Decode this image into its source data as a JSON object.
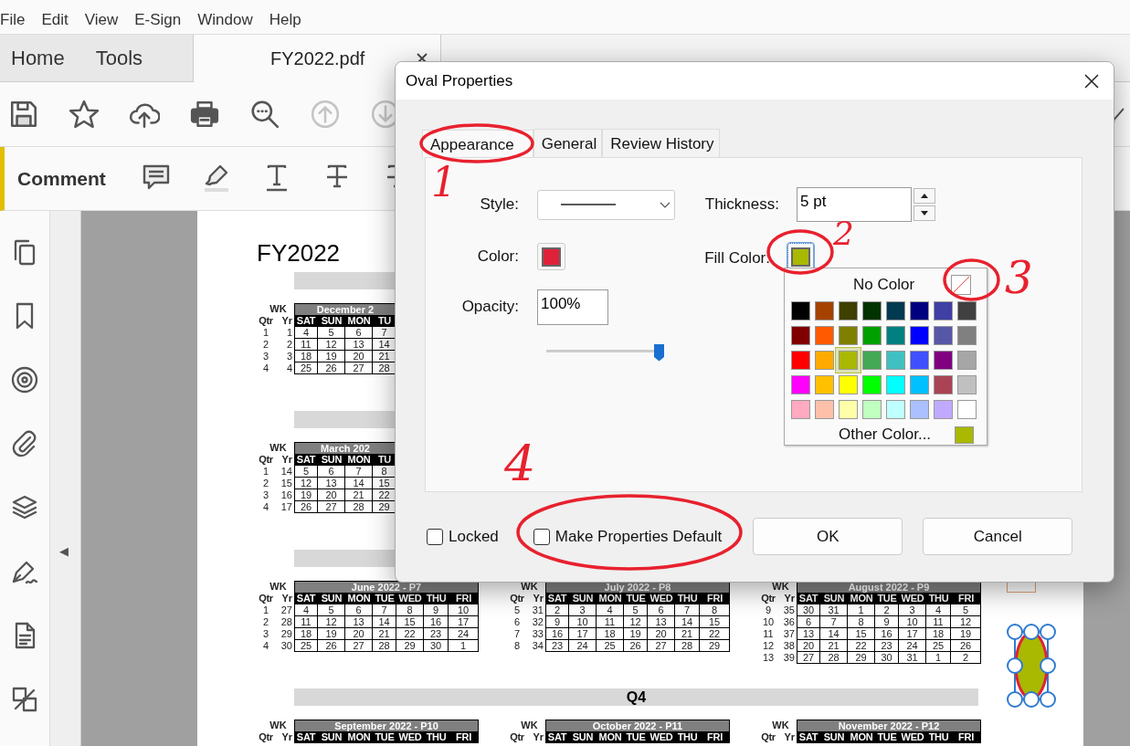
{
  "menu_bar": [
    "File",
    "Edit",
    "View",
    "E-Sign",
    "Window",
    "Help"
  ],
  "nav_tabs": [
    {
      "label": "Home",
      "selected": false,
      "closable": false
    },
    {
      "label": "Tools",
      "selected": false,
      "closable": false
    },
    {
      "label": "FY2022.pdf",
      "selected": true,
      "closable": true
    }
  ],
  "toolbar": {
    "left": [
      {
        "kind": "save",
        "disabled": false
      },
      {
        "kind": "star",
        "disabled": false
      },
      {
        "kind": "upload",
        "disabled": false
      },
      {
        "kind": "print",
        "disabled": false
      },
      {
        "kind": "search",
        "disabled": false
      },
      {
        "kind": "up",
        "disabled": true
      },
      {
        "kind": "down",
        "disabled": true
      }
    ],
    "right": [
      {
        "kind": "pen",
        "disabled": false
      }
    ]
  },
  "comment_bar": {
    "title": "Comment",
    "tools": [
      {
        "kind": "comment"
      },
      {
        "kind": "highlight"
      },
      {
        "kind": "underline"
      },
      {
        "kind": "strikethrough"
      },
      {
        "kind": "strikethrough"
      }
    ]
  },
  "sidebar": [
    {
      "kind": "pages"
    },
    {
      "kind": "bookmark"
    },
    {
      "kind": "target"
    },
    {
      "kind": "attachment"
    },
    {
      "kind": "layers"
    },
    {
      "kind": "sign"
    },
    {
      "kind": "document"
    },
    {
      "kind": "compare"
    }
  ],
  "collapse_arrow": "◀",
  "document": {
    "title": "FY2022",
    "sections": [
      {
        "calendars": [
          {
            "title": "December 2",
            "labels": [
              "WK",
              "Qtr",
              "Yr"
            ],
            "weekdays": [
              "SAT",
              "SUN",
              "MON",
              "TU"
            ],
            "weeks": [
              {
                "qtr": "1",
                "yr": "1",
                "days": [
                  "4",
                  "5",
                  "6",
                  "7"
                ]
              },
              {
                "qtr": "2",
                "yr": "2",
                "days": [
                  "11",
                  "12",
                  "13",
                  "14"
                ]
              },
              {
                "qtr": "3",
                "yr": "3",
                "days": [
                  "18",
                  "19",
                  "20",
                  "21"
                ]
              },
              {
                "qtr": "4",
                "yr": "4",
                "days": [
                  "25",
                  "26",
                  "27",
                  "28"
                ]
              }
            ]
          }
        ]
      },
      {
        "calendars": [
          {
            "title": "March 202",
            "labels": [
              "WK",
              "Qtr",
              "Yr"
            ],
            "weekdays": [
              "SAT",
              "SUN",
              "MON",
              "TU"
            ],
            "weeks": [
              {
                "qtr": "1",
                "yr": "14",
                "days": [
                  "5",
                  "6",
                  "7",
                  "8"
                ]
              },
              {
                "qtr": "2",
                "yr": "15",
                "days": [
                  "12",
                  "13",
                  "14",
                  "15"
                ]
              },
              {
                "qtr": "3",
                "yr": "16",
                "days": [
                  "19",
                  "20",
                  "21",
                  "22"
                ]
              },
              {
                "qtr": "4",
                "yr": "17",
                "days": [
                  "26",
                  "27",
                  "28",
                  "29"
                ]
              }
            ]
          }
        ]
      },
      {
        "calendars": [
          {
            "title": "June 2022 - P7",
            "labels": [
              "WK",
              "Qtr",
              "Yr"
            ],
            "weekdays": [
              "SAT",
              "SUN",
              "MON",
              "TUE",
              "WED",
              "THU",
              "FRI"
            ],
            "weeks": [
              {
                "qtr": "1",
                "yr": "27",
                "days": [
                  "4",
                  "5",
                  "6",
                  "7",
                  "8",
                  "9",
                  "10"
                ]
              },
              {
                "qtr": "2",
                "yr": "28",
                "days": [
                  "11",
                  "12",
                  "13",
                  "14",
                  "15",
                  "16",
                  "17"
                ]
              },
              {
                "qtr": "3",
                "yr": "29",
                "days": [
                  "18",
                  "19",
                  "20",
                  "21",
                  "22",
                  "23",
                  "24"
                ]
              },
              {
                "qtr": "4",
                "yr": "30",
                "days": [
                  "25",
                  "26",
                  "27",
                  "28",
                  "29",
                  "30",
                  "1"
                ]
              }
            ]
          },
          {
            "title": "July 2022 - P8",
            "labels": [
              "WK",
              "Qtr",
              "Yr"
            ],
            "weekdays": [
              "SAT",
              "SUN",
              "MON",
              "TUE",
              "WED",
              "THU",
              "FRI"
            ],
            "weeks": [
              {
                "qtr": "5",
                "yr": "31",
                "days": [
                  "2",
                  "3",
                  "4",
                  "5",
                  "6",
                  "7",
                  "8"
                ]
              },
              {
                "qtr": "6",
                "yr": "32",
                "days": [
                  "9",
                  "10",
                  "11",
                  "12",
                  "13",
                  "14",
                  "15"
                ]
              },
              {
                "qtr": "7",
                "yr": "33",
                "days": [
                  "16",
                  "17",
                  "18",
                  "19",
                  "20",
                  "21",
                  "22"
                ]
              },
              {
                "qtr": "8",
                "yr": "34",
                "days": [
                  "23",
                  "24",
                  "25",
                  "26",
                  "27",
                  "28",
                  "29"
                ]
              }
            ]
          },
          {
            "title": "August 2022 - P9",
            "labels": [
              "WK",
              "Qtr",
              "Yr"
            ],
            "weekdays": [
              "SAT",
              "SUN",
              "MON",
              "TUE",
              "WED",
              "THU",
              "FRI"
            ],
            "weeks": [
              {
                "qtr": "9",
                "yr": "35",
                "days": [
                  "30",
                  "31",
                  "1",
                  "2",
                  "3",
                  "4",
                  "5"
                ]
              },
              {
                "qtr": "10",
                "yr": "36",
                "days": [
                  "6",
                  "7",
                  "8",
                  "9",
                  "10",
                  "11",
                  "12"
                ]
              },
              {
                "qtr": "11",
                "yr": "37",
                "days": [
                  "13",
                  "14",
                  "15",
                  "16",
                  "17",
                  "18",
                  "19"
                ]
              },
              {
                "qtr": "12",
                "yr": "38",
                "days": [
                  "20",
                  "21",
                  "22",
                  "23",
                  "24",
                  "25",
                  "26"
                ]
              },
              {
                "qtr": "13",
                "yr": "39",
                "days": [
                  "27",
                  "28",
                  "29",
                  "30",
                  "31",
                  "1",
                  "2"
                ]
              }
            ]
          }
        ]
      },
      {
        "heading": "Q4",
        "calendars": [
          {
            "title": "September 2022 - P10",
            "labels": [
              "WK",
              "Qtr",
              "Yr"
            ],
            "weekdays": [
              "SAT",
              "SUN",
              "MON",
              "TUE",
              "WED",
              "THU",
              "FRI"
            ]
          },
          {
            "title": "October 2022 - P11",
            "labels": [
              "WK",
              "Qtr",
              "Yr"
            ],
            "weekdays": [
              "SAT",
              "SUN",
              "MON",
              "TUE",
              "WED",
              "THU",
              "FRI"
            ]
          },
          {
            "title": "November 2022 - P12",
            "labels": [
              "WK",
              "Qtr",
              "Yr"
            ],
            "weekdays": [
              "SAT",
              "SUN",
              "MON",
              "TUE",
              "WED",
              "THU",
              "FRI"
            ]
          }
        ]
      }
    ]
  },
  "dialog": {
    "title": "Oval Properties",
    "tabs": [
      {
        "label": "Appearance",
        "selected": true
      },
      {
        "label": "General",
        "selected": false
      },
      {
        "label": "Review History",
        "selected": false
      }
    ],
    "style": {
      "label": "Style:"
    },
    "thickness": {
      "label": "Thickness:",
      "value": "5 pt"
    },
    "color": {
      "label": "Color:",
      "color": "#e0213a"
    },
    "fill_color": {
      "label": "Fill Color:",
      "color": "#a9b800"
    },
    "opacity": {
      "label": "Opacity:",
      "value": "100%",
      "level": 1
    },
    "palette": {
      "no_color": "No Color",
      "other_color": "Other Color...",
      "custom": {
        "color": "#a9b800"
      },
      "swatches": [
        {
          "color": "#000000",
          "selected": false
        },
        {
          "color": "#a54200",
          "selected": false
        },
        {
          "color": "#3f3f00",
          "selected": false
        },
        {
          "color": "#003300",
          "selected": false
        },
        {
          "color": "#003a50",
          "selected": false
        },
        {
          "color": "#000080",
          "selected": false
        },
        {
          "color": "#3f3fa5",
          "selected": false
        },
        {
          "color": "#404040",
          "selected": false
        },
        {
          "color": "#800000",
          "selected": false
        },
        {
          "color": "#ff5a00",
          "selected": false
        },
        {
          "color": "#808000",
          "selected": false
        },
        {
          "color": "#00a000",
          "selected": false
        },
        {
          "color": "#008080",
          "selected": false
        },
        {
          "color": "#0000ff",
          "selected": false
        },
        {
          "color": "#5757a8",
          "selected": false
        },
        {
          "color": "#808080",
          "selected": false
        },
        {
          "color": "#ff0000",
          "selected": false
        },
        {
          "color": "#ffaa00",
          "selected": false
        },
        {
          "color": "#a9b800",
          "selected": true
        },
        {
          "color": "#44a855",
          "selected": false
        },
        {
          "color": "#40c0c0",
          "selected": false
        },
        {
          "color": "#4050ff",
          "selected": false
        },
        {
          "color": "#800080",
          "selected": false
        },
        {
          "color": "#a6a6a6",
          "selected": false
        },
        {
          "color": "#ff00ff",
          "selected": false
        },
        {
          "color": "#ffc000",
          "selected": false
        },
        {
          "color": "#ffff00",
          "selected": false
        },
        {
          "color": "#00ff00",
          "selected": false
        },
        {
          "color": "#00ffff",
          "selected": false
        },
        {
          "color": "#00c0ff",
          "selected": false
        },
        {
          "color": "#aa4455",
          "selected": false
        },
        {
          "color": "#c0c0c0",
          "selected": false
        },
        {
          "color": "#ffaac0",
          "selected": false
        },
        {
          "color": "#ffc0aa",
          "selected": false
        },
        {
          "color": "#ffffaa",
          "selected": false
        },
        {
          "color": "#c0ffc0",
          "selected": false
        },
        {
          "color": "#c0ffff",
          "selected": false
        },
        {
          "color": "#aac0ff",
          "selected": false
        },
        {
          "color": "#c0aaff",
          "selected": false
        },
        {
          "color": "#ffffff",
          "selected": false
        }
      ]
    },
    "checkboxes": [
      {
        "label": "Locked",
        "checked": false
      },
      {
        "label": "Make Properties Default",
        "checked": false
      }
    ],
    "buttons": [
      "OK",
      "Cancel"
    ]
  },
  "annotations": [
    {
      "number": "1"
    },
    {
      "number": "2"
    },
    {
      "number": "3"
    },
    {
      "number": "4"
    }
  ]
}
